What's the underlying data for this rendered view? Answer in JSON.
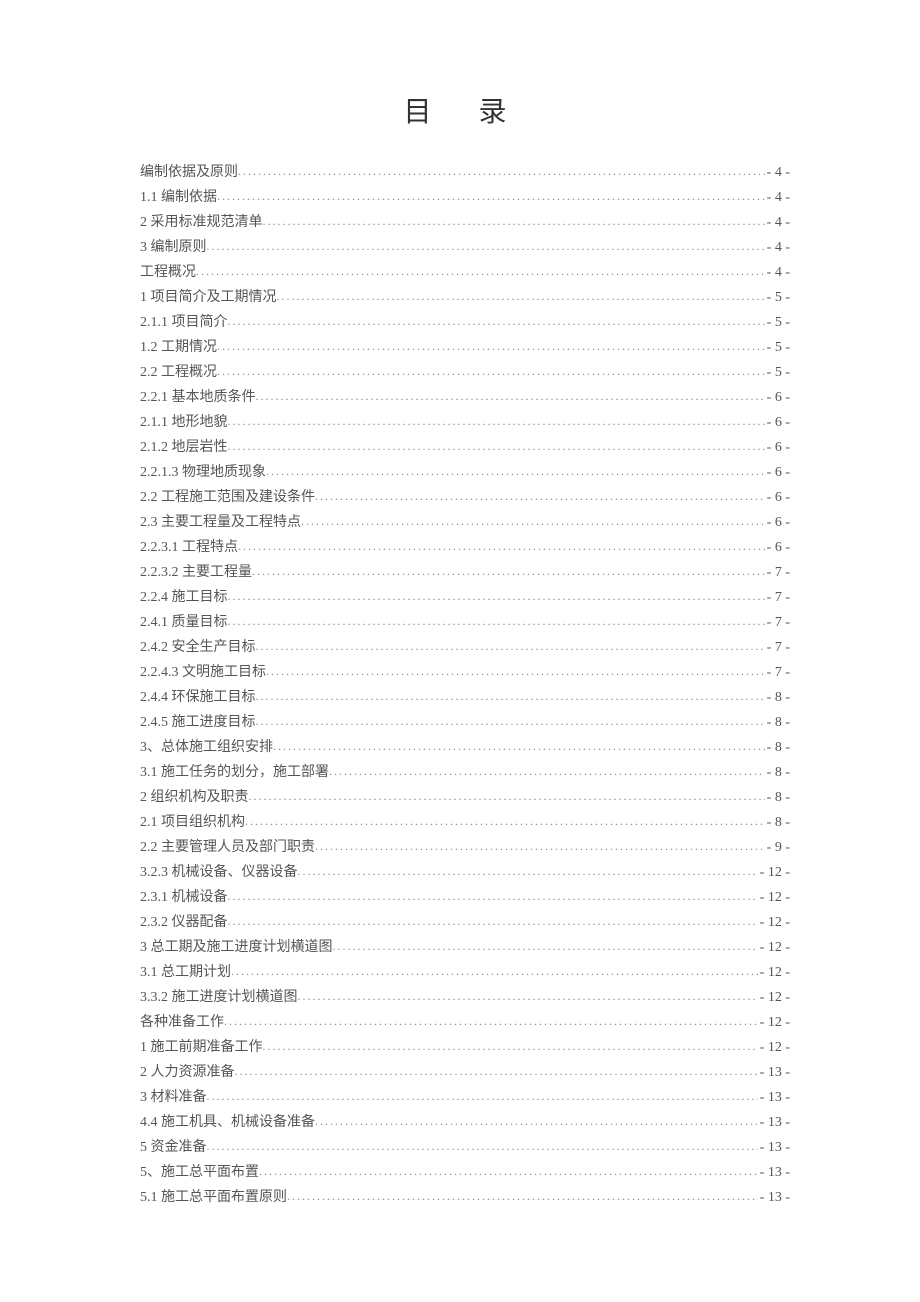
{
  "title": "目 录",
  "entries": [
    {
      "label": "编制依据及原则",
      "page": "- 4 -"
    },
    {
      "label": "1.1 编制依据",
      "page": "- 4 -"
    },
    {
      "label": "2 采用标准规范清单",
      "page": "- 4 -"
    },
    {
      "label": "3 编制原则",
      "page": "- 4 -"
    },
    {
      "label": "工程概况",
      "page": "- 4 -"
    },
    {
      "label": "1 项目简介及工期情况",
      "page": "- 5 -"
    },
    {
      "label": "2.1.1 项目简介",
      "page": "- 5 -"
    },
    {
      "label": "1.2 工期情况",
      "page": "- 5 -"
    },
    {
      "label": "2.2 工程概况",
      "page": "- 5 -"
    },
    {
      "label": "2.2.1 基本地质条件",
      "page": "- 6 -"
    },
    {
      "label": "2.1.1 地形地貌",
      "page": "- 6 -"
    },
    {
      "label": "2.1.2 地层岩性",
      "page": "- 6 -"
    },
    {
      "label": "2.2.1.3 物理地质现象",
      "page": "- 6 -"
    },
    {
      "label": "2.2  工程施工范围及建设条件",
      "page": "- 6 -"
    },
    {
      "label": "2.3 主要工程量及工程特点",
      "page": "- 6 -"
    },
    {
      "label": "2.2.3.1 工程特点",
      "page": "- 6 -"
    },
    {
      "label": "2.2.3.2 主要工程量",
      "page": "- 7 -"
    },
    {
      "label": "2.2.4 施工目标",
      "page": "- 7 -"
    },
    {
      "label": "2.4.1 质量目标",
      "page": "- 7 -"
    },
    {
      "label": "2.4.2 安全生产目标",
      "page": "- 7 -"
    },
    {
      "label": "2.2.4.3 文明施工目标",
      "page": "- 7 -"
    },
    {
      "label": "2.4.4 环保施工目标",
      "page": "- 8 -"
    },
    {
      "label": "2.4.5 施工进度目标",
      "page": "- 8 -"
    },
    {
      "label": "3、总体施工组织安排",
      "page": "- 8 -"
    },
    {
      "label": "3.1 施工任务的划分，施工部署",
      "page": "- 8 -"
    },
    {
      "label": "2 组织机构及职责",
      "page": "- 8 -"
    },
    {
      "label": "2.1 项目组织机构",
      "page": "- 8 -"
    },
    {
      "label": "2.2 主要管理人员及部门职责",
      "page": "- 9 -"
    },
    {
      "label": "3.2.3 机械设备、仪器设备",
      "page": "- 12 -"
    },
    {
      "label": "2.3.1 机械设备",
      "page": "- 12 -"
    },
    {
      "label": "2.3.2 仪器配备",
      "page": "- 12 -"
    },
    {
      "label": "3  总工期及施工进度计划横道图",
      "page": "- 12 -"
    },
    {
      "label": "3.1  总工期计划",
      "page": "- 12 -"
    },
    {
      "label": "3.3.2  施工进度计划横道图",
      "page": "- 12 -"
    },
    {
      "label": "各种准备工作",
      "page": "- 12 -"
    },
    {
      "label": "1 施工前期准备工作",
      "page": "- 12 -"
    },
    {
      "label": "2 人力资源准备",
      "page": "- 13 -"
    },
    {
      "label": "3 材料准备",
      "page": "- 13 -"
    },
    {
      "label": "4.4 施工机具、机械设备准备",
      "page": "- 13 -"
    },
    {
      "label": "5 资金准备",
      "page": "- 13 -"
    },
    {
      "label": "5、施工总平面布置",
      "page": "- 13 -"
    },
    {
      "label": "5.1 施工总平面布置原则",
      "page": "- 13 -"
    }
  ]
}
